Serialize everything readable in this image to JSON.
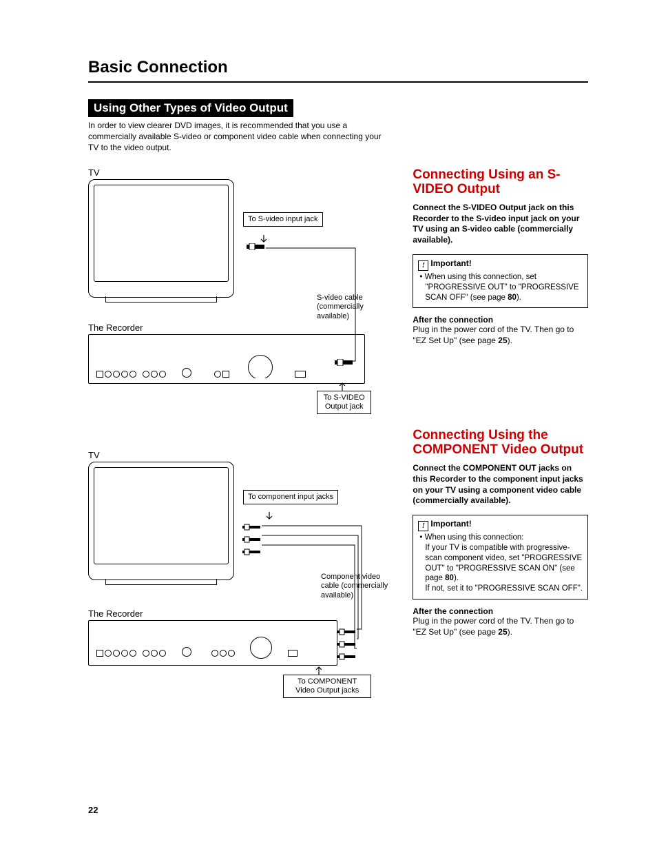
{
  "main_title": "Basic Connection",
  "section_title": "Using Other Types of Video Output",
  "intro": "In order to view clearer DVD images, it is recommended that you use a commercially available S-video or component video cable when connecting your TV to the video output.",
  "diagram1": {
    "tv_label": "TV",
    "callout_input": "To S-video input jack",
    "cable_label": "S-video cable (commercially available)",
    "recorder_label": "The Recorder",
    "callout_output": "To S-VIDEO Output jack"
  },
  "diagram2": {
    "tv_label": "TV",
    "callout_input": "To component input jacks",
    "cable_label": "Component video cable (commercially available)",
    "recorder_label": "The Recorder",
    "callout_output": "To COMPONENT Video Output jacks"
  },
  "right1": {
    "heading": "Connecting Using an S-VIDEO Output",
    "bold_copy": "Connect the S-VIDEO Output jack on this Recorder to the S-video input jack on your TV using an S-video cable (commercially available).",
    "important_label": "Important!",
    "important_body_a": "When using this connection, set \"PROGRESSIVE OUT\" to \"PROGRESSIVE SCAN OFF\" (see page ",
    "important_page": "80",
    "important_body_b": ").",
    "after_head": "After the connection",
    "after_body_a": "Plug in the power cord of the TV. Then go to \"EZ Set Up\" (see page ",
    "after_page": "25",
    "after_body_b": ")."
  },
  "right2": {
    "heading": "Connecting Using the COMPONENT Video Output",
    "bold_copy": "Connect the COMPONENT OUT jacks on this Recorder to the component input jacks on your TV using a component video cable (commercially available).",
    "important_label": "Important!",
    "important_line1": "When using this connection:",
    "important_line2a": "If your TV is compatible with progressive-scan component video, set \"PROGRESSIVE OUT\" to \"PROGRESSIVE SCAN ON\" (see page ",
    "important_page": "80",
    "important_line2b": ").",
    "important_line3": "If not, set it to \"PROGRESSIVE SCAN OFF\".",
    "after_head": "After the connection",
    "after_body_a": "Plug in the power cord of the TV. Then go to \"EZ Set Up\" (see page ",
    "after_page": "25",
    "after_body_b": ")."
  },
  "page_number": "22"
}
